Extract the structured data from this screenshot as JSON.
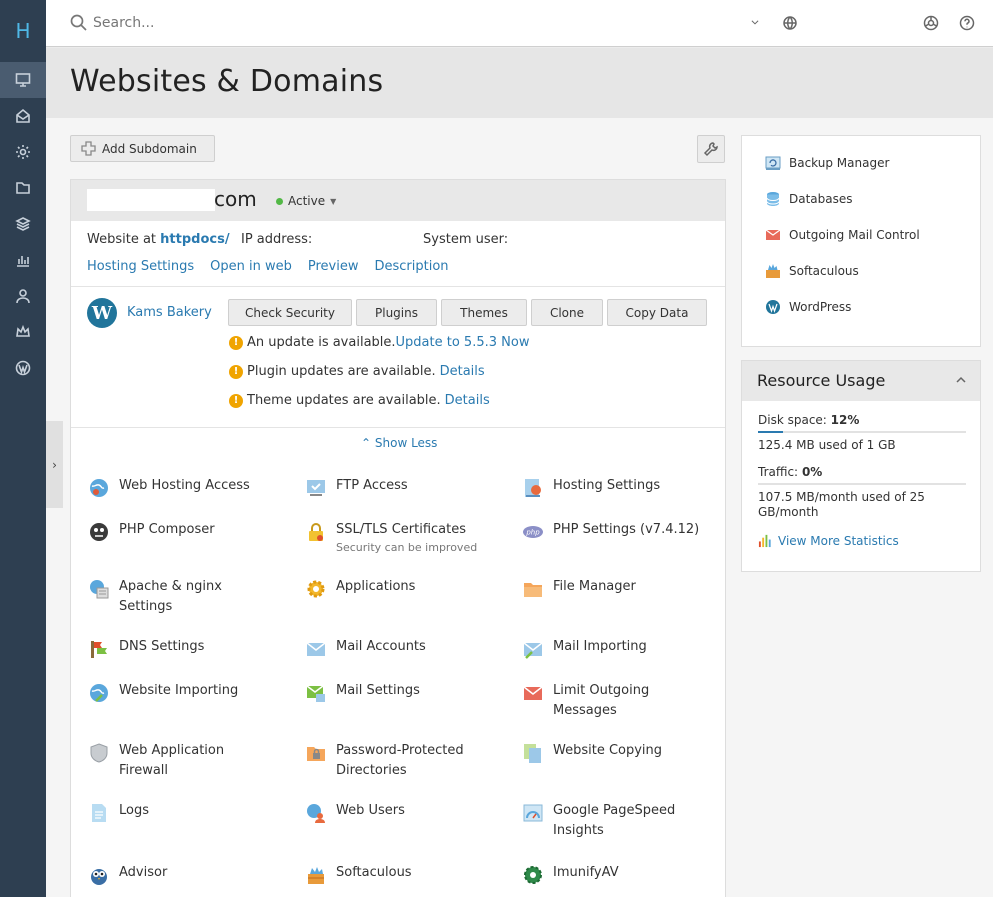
{
  "rail": {
    "logo": "H"
  },
  "topbar": {
    "search_placeholder": "Search..."
  },
  "page": {
    "title": "Websites & Domains"
  },
  "toolbar": {
    "add_subdomain": "Add Subdomain"
  },
  "domain": {
    "name_suffix": "com",
    "status": "Active",
    "website_at_label": "Website at",
    "website_at_value": "httpdocs/",
    "ip_label": "IP address:",
    "system_user_label": "System user:",
    "links": [
      "Hosting Settings",
      "Open in web",
      "Preview",
      "Description"
    ]
  },
  "wordpress": {
    "site_name": "Kams Bakery",
    "buttons": [
      "Check Security",
      "Plugins",
      "Themes",
      "Clone",
      "Copy Data"
    ],
    "notices": [
      {
        "text": "An update is available.",
        "link": "Update to 5.5.3 Now"
      },
      {
        "text": "Plugin updates are available.",
        "link": "Details"
      },
      {
        "text": "Theme updates are available.",
        "link": "Details"
      }
    ],
    "show_less": "Show Less"
  },
  "tools": [
    {
      "label": "Web Hosting Access",
      "icon": "globe-user-icon"
    },
    {
      "label": "FTP Access",
      "icon": "ftp-icon"
    },
    {
      "label": "Hosting Settings",
      "icon": "hosting-settings-icon"
    },
    {
      "label": "PHP Composer",
      "icon": "php-composer-icon"
    },
    {
      "label": "SSL/TLS Certificates",
      "sub": "Security can be improved",
      "icon": "lock-icon"
    },
    {
      "label": "PHP Settings (v7.4.12)",
      "icon": "php-icon"
    },
    {
      "label": "Apache & nginx Settings",
      "icon": "apache-icon"
    },
    {
      "label": "Applications",
      "icon": "gear-icon"
    },
    {
      "label": "File Manager",
      "icon": "folder-icon"
    },
    {
      "label": "DNS Settings",
      "icon": "dns-icon"
    },
    {
      "label": "Mail Accounts",
      "icon": "mail-icon"
    },
    {
      "label": "Mail Importing",
      "icon": "mail-import-icon"
    },
    {
      "label": "Website Importing",
      "icon": "website-import-icon"
    },
    {
      "label": "Mail Settings",
      "icon": "mail-settings-icon"
    },
    {
      "label": "Limit Outgoing Messages",
      "icon": "mail-limit-icon"
    },
    {
      "label": "Web Application Firewall",
      "icon": "shield-icon"
    },
    {
      "label": "Password-Protected Directories",
      "icon": "protected-folder-icon"
    },
    {
      "label": "Website Copying",
      "icon": "copy-icon"
    },
    {
      "label": "Logs",
      "icon": "logs-icon"
    },
    {
      "label": "Web Users",
      "icon": "web-users-icon"
    },
    {
      "label": "Google PageSpeed Insights",
      "icon": "pagespeed-icon"
    },
    {
      "label": "Advisor",
      "icon": "owl-icon"
    },
    {
      "label": "Softaculous",
      "icon": "softaculous-icon"
    },
    {
      "label": "ImunifyAV",
      "icon": "imunify-icon"
    }
  ],
  "quick_links": [
    {
      "label": "Backup Manager",
      "icon": "backup-icon"
    },
    {
      "label": "Databases",
      "icon": "database-icon"
    },
    {
      "label": "Outgoing Mail Control",
      "icon": "mail-control-icon"
    },
    {
      "label": "Softaculous",
      "icon": "softaculous-icon"
    },
    {
      "label": "WordPress",
      "icon": "wordpress-icon"
    }
  ],
  "resource_usage": {
    "title": "Resource Usage",
    "disk_label": "Disk space:",
    "disk_percent": "12%",
    "disk_detail": "125.4 MB used of 1 GB",
    "traffic_label": "Traffic:",
    "traffic_percent": "0%",
    "traffic_detail_1": "107.5 MB/month used of 25",
    "traffic_detail_2": "GB/month",
    "disk_fill": 0.12,
    "traffic_fill": 0.0,
    "stats_link": "View More Statistics"
  }
}
